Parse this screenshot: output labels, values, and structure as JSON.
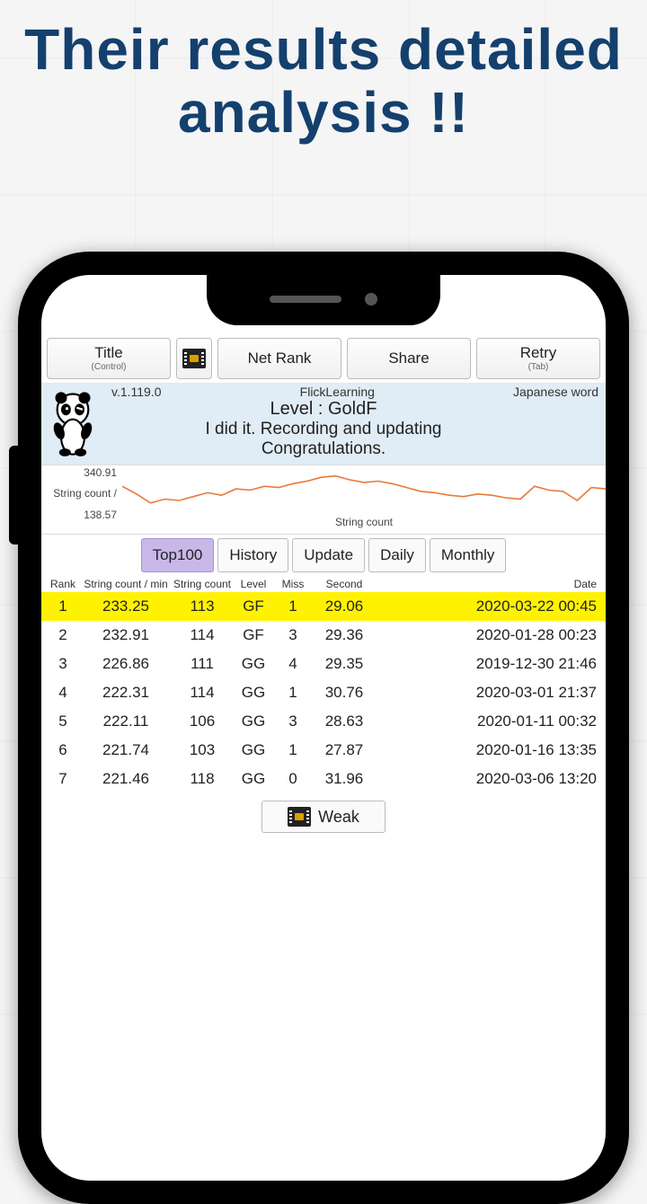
{
  "headline": "Their results detailed analysis !!",
  "toolbar": {
    "title_label": "Title",
    "title_sub": "(Control)",
    "netrank_label": "Net Rank",
    "share_label": "Share",
    "retry_label": "Retry",
    "retry_sub": "(Tab)"
  },
  "banner": {
    "version": "v.1.119.0",
    "app_name": "FlickLearning",
    "mode": "Japanese word",
    "level": "Level : GoldF",
    "msg1": "I did it. Recording and updating",
    "msg2": "Congratulations."
  },
  "tabs": [
    "Top100",
    "History",
    "Update",
    "Daily",
    "Monthly"
  ],
  "tabs_active_index": 0,
  "table": {
    "headers": {
      "rank": "Rank",
      "scm": "String count / min",
      "sc": "String count",
      "lvl": "Level",
      "miss": "Miss",
      "sec": "Second",
      "date": "Date"
    },
    "rows": [
      {
        "rank": "1",
        "scm": "233.25",
        "sc": "113",
        "lvl": "GF",
        "miss": "1",
        "sec": "29.06",
        "date": "2020-03-22 00:45",
        "hl": true
      },
      {
        "rank": "2",
        "scm": "232.91",
        "sc": "114",
        "lvl": "GF",
        "miss": "3",
        "sec": "29.36",
        "date": "2020-01-28 00:23"
      },
      {
        "rank": "3",
        "scm": "226.86",
        "sc": "111",
        "lvl": "GG",
        "miss": "4",
        "sec": "29.35",
        "date": "2019-12-30 21:46"
      },
      {
        "rank": "4",
        "scm": "222.31",
        "sc": "114",
        "lvl": "GG",
        "miss": "1",
        "sec": "30.76",
        "date": "2020-03-01 21:37"
      },
      {
        "rank": "5",
        "scm": "222.11",
        "sc": "106",
        "lvl": "GG",
        "miss": "3",
        "sec": "28.63",
        "date": "2020-01-11 00:32"
      },
      {
        "rank": "6",
        "scm": "221.74",
        "sc": "103",
        "lvl": "GG",
        "miss": "1",
        "sec": "27.87",
        "date": "2020-01-16 13:35"
      },
      {
        "rank": "7",
        "scm": "221.46",
        "sc": "118",
        "lvl": "GG",
        "miss": "0",
        "sec": "31.96",
        "date": "2020-03-06 13:20"
      }
    ]
  },
  "weak_label": "Weak",
  "chart_data": {
    "type": "line",
    "title": "",
    "ylabel": "String count /",
    "xlabel": "String count",
    "ylim": [
      138.57,
      340.91
    ],
    "ymax_label": "340.91",
    "ymin_label": "138.57",
    "series": [
      {
        "name": "String count",
        "values": [
          260,
          230,
          195,
          210,
          205,
          220,
          235,
          225,
          250,
          245,
          260,
          255,
          270,
          280,
          295,
          300,
          285,
          275,
          280,
          270,
          255,
          240,
          235,
          225,
          220,
          230,
          225,
          215,
          210,
          260,
          245,
          240,
          205,
          255,
          250
        ]
      }
    ]
  }
}
